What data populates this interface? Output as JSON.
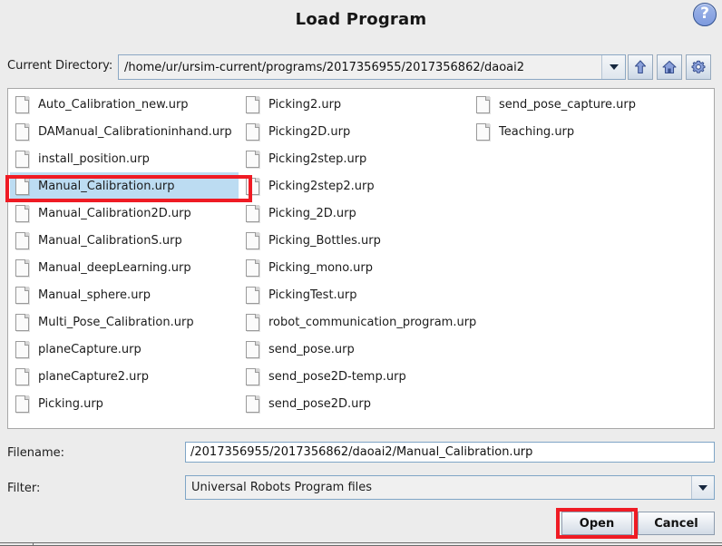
{
  "dialog": {
    "title": "Load Program",
    "help_icon": "help-icon",
    "help_glyph": "?"
  },
  "directory": {
    "label": "Current Directory:",
    "value": "/home/ur/ursim-current/programs/2017356955/2017356862/daoai2"
  },
  "toolbar": {
    "up_icon": "up-arrow-icon",
    "home_icon": "home-icon",
    "settings_icon": "gear-icon"
  },
  "file_list": {
    "selected": "Manual_Calibration.urp",
    "columns": [
      [
        "Auto_Calibration_new.urp",
        "DAManual_Calibrationinhand.urp",
        "install_position.urp",
        "Manual_Calibration.urp",
        "Manual_Calibration2D.urp",
        "Manual_CalibrationS.urp",
        "Manual_deepLearning.urp",
        "Manual_sphere.urp",
        "Multi_Pose_Calibration.urp",
        "planeCapture.urp",
        "planeCapture2.urp",
        "Picking.urp"
      ],
      [
        "Picking2.urp",
        "Picking2D.urp",
        "Picking2step.urp",
        "Picking2step2.urp",
        "Picking_2D.urp",
        "Picking_Bottles.urp",
        "Picking_mono.urp",
        "PickingTest.urp",
        "robot_communication_program.urp",
        "send_pose.urp",
        "send_pose2D-temp.urp",
        "send_pose2D.urp"
      ],
      [
        "send_pose_capture.urp",
        "Teaching.urp"
      ]
    ]
  },
  "filename": {
    "label": "Filename:",
    "value": "/2017356955/2017356862/daoai2/Manual_Calibration.urp"
  },
  "filter": {
    "label": "Filter:",
    "value": "Universal Robots Program files"
  },
  "actions": {
    "open_label": "Open",
    "cancel_label": "Cancel"
  },
  "colors": {
    "dialog_background": "#ececec",
    "list_background": "#ffffff",
    "selection": "#bcdcf2",
    "annotation_red": "#ef1b24",
    "accent_blue": "#7e9ade"
  }
}
